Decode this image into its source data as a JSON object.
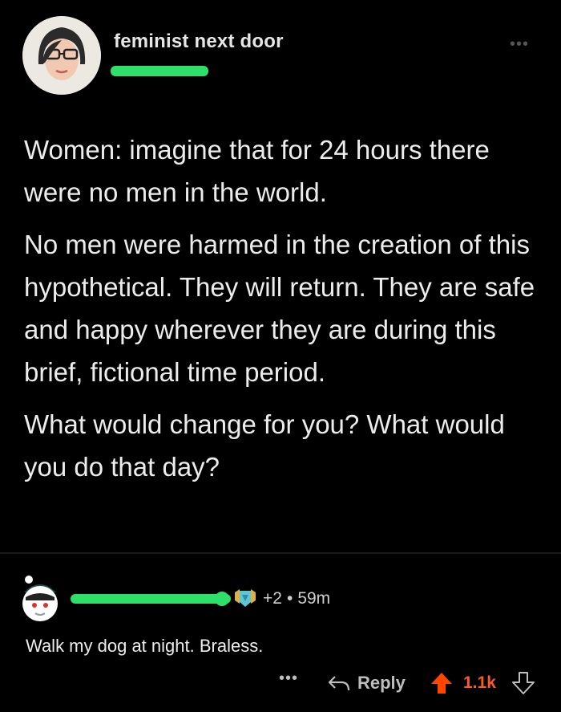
{
  "post": {
    "author": "feminist next door",
    "menu_icon": "more-horizontal-icon",
    "paragraphs": [
      "Women: imagine that for 24 hours there were no men in the world.",
      "No men were harmed in the creation of this hypothetical. They will return. They are safe and happy wherever they are during this brief, fictional time period.",
      "What would change for you? What would you do that day?"
    ]
  },
  "comment": {
    "award_count": "+2",
    "separator": "•",
    "age": "59m",
    "text": "Walk my dog at night. Braless.",
    "actions": {
      "more": "•••",
      "reply_label": "Reply",
      "score": "1.1k"
    }
  },
  "colors": {
    "background": "#000000",
    "redaction": "#2ee06a",
    "upvote": "#ff4500",
    "score": "#ff5a1f"
  }
}
